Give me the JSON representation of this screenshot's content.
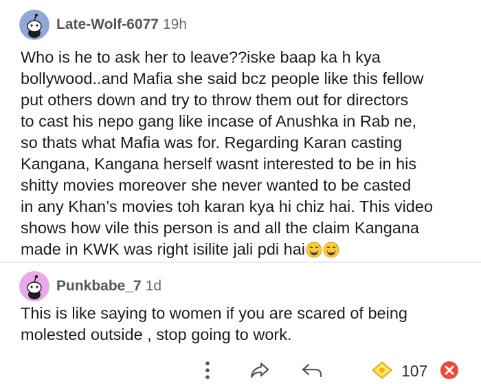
{
  "comments": [
    {
      "username": "Late-Wolf-6077",
      "age": "19h",
      "lines": [
        "Who is he to ask her to leave??iske baap ka h kya",
        "bollywood..and Mafia she said bcz people like this fellow",
        "put others down and try to throw them out for directors",
        "to cast his nepo gang like incase of Anushka in Rab ne,",
        "so thats what Mafia was for. Regarding Karan casting",
        "Kangana, Kangana herself wasnt interested to be in his",
        "shitty movies moreover she never wanted to be casted",
        "in any Khan’s movies toh karan kya hi chiz hai. This video",
        "shows how vile this person is and all the claim Kangana",
        "made in KWK was right isilite jali pdi hai"
      ],
      "emojis": [
        "grinning-sweat-emoji",
        "grinning-sweat-emoji"
      ],
      "avatar_color": "#8fa8d8"
    },
    {
      "username": "Punkbabe_7",
      "age": "1d",
      "lines": [
        "This is like saying to women if you are scared of being",
        "molested outside , stop going to work."
      ],
      "avatar_color": "#e9a8e8",
      "actions": {
        "vote_count": "107",
        "icons": [
          "more-options-icon",
          "share-icon",
          "reply-icon",
          "award-icon",
          "downvote-icon"
        ]
      }
    }
  ]
}
